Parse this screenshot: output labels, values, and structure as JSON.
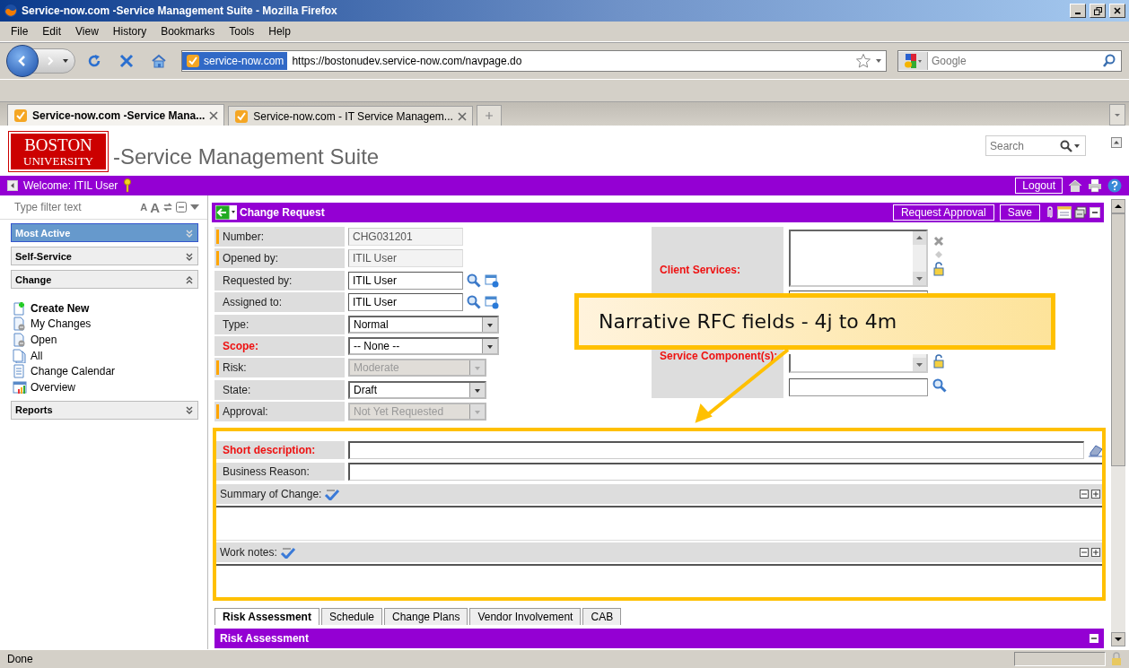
{
  "window": {
    "title": "Service-now.com -Service Management Suite - Mozilla Firefox"
  },
  "menu": [
    "File",
    "Edit",
    "View",
    "History",
    "Bookmarks",
    "Tools",
    "Help"
  ],
  "address": {
    "site": "service-now.com",
    "url": "https://bostonudev.service-now.com/navpage.do"
  },
  "web_search": {
    "placeholder": "Google"
  },
  "browser_tabs": [
    {
      "label": "Service-now.com -Service Mana...",
      "selected": true
    },
    {
      "label": "Service-now.com - IT Service Managem...",
      "selected": false
    }
  ],
  "header": {
    "logo": [
      "BOSTON",
      "UNIVERSITY"
    ],
    "title": "-Service Management Suite",
    "search_placeholder": "Search"
  },
  "user_bar": {
    "welcome": "Welcome: ITIL User",
    "logout": "Logout"
  },
  "sidebar": {
    "filter_placeholder": "Type filter text",
    "font_controls": [
      "A",
      "A"
    ],
    "sections": [
      {
        "label": "Most Active",
        "selected": true,
        "expanded": false
      },
      {
        "label": "Self-Service",
        "selected": false,
        "expanded": false
      },
      {
        "label": "Change",
        "selected": false,
        "expanded": true,
        "items": [
          {
            "label": "Create New",
            "kind": "create"
          },
          {
            "label": "My Changes",
            "kind": "filter"
          },
          {
            "label": "Open",
            "kind": "filter"
          },
          {
            "label": "All",
            "kind": "list"
          },
          {
            "label": "Change Calendar",
            "kind": "calendar"
          },
          {
            "label": "Overview",
            "kind": "chart"
          }
        ]
      },
      {
        "label": "Reports",
        "selected": false,
        "expanded": false
      }
    ]
  },
  "form": {
    "title": "Change Request",
    "buttons": [
      "Request Approval",
      "Save"
    ],
    "fields": [
      {
        "label": "Number:",
        "value": "CHG031201",
        "kind": "readonly",
        "mandatory": true,
        "required": false
      },
      {
        "label": "Opened by:",
        "value": "ITIL User",
        "kind": "readonly",
        "mandatory": true,
        "required": false
      },
      {
        "label": "Requested by:",
        "value": "ITIL User",
        "kind": "reference",
        "mandatory": false,
        "required": false
      },
      {
        "label": "Assigned to:",
        "value": "ITIL User",
        "kind": "reference",
        "mandatory": false,
        "required": false
      },
      {
        "label": "Type:",
        "value": "Normal",
        "kind": "select",
        "mandatory": false,
        "required": false,
        "disabled": false
      },
      {
        "label": "Scope:",
        "value": "-- None --",
        "kind": "select",
        "mandatory": false,
        "required": true,
        "disabled": false
      },
      {
        "label": "Risk:",
        "value": "Moderate",
        "kind": "select",
        "mandatory": true,
        "required": false,
        "disabled": true
      },
      {
        "label": "State:",
        "value": "Draft",
        "kind": "select",
        "mandatory": false,
        "required": false,
        "disabled": false
      },
      {
        "label": "Approval:",
        "value": "Not Yet Requested",
        "kind": "select",
        "mandatory": true,
        "required": false,
        "disabled": true
      }
    ],
    "side_labels": [
      "Client Services:",
      "Service Component(s):"
    ],
    "narrative": [
      {
        "label": "Short description:",
        "kind": "input",
        "required": true
      },
      {
        "label": "Business Reason:",
        "kind": "input",
        "required": false
      },
      {
        "label": "Summary of Change:",
        "kind": "journal",
        "required": false
      },
      {
        "label": "Work notes:",
        "kind": "journal",
        "required": false
      }
    ],
    "section_tabs": [
      {
        "label": "Risk Assessment",
        "selected": true
      },
      {
        "label": "Schedule",
        "selected": false
      },
      {
        "label": "Change Plans",
        "selected": false
      },
      {
        "label": "Vendor Involvement",
        "selected": false
      },
      {
        "label": "CAB",
        "selected": false
      }
    ],
    "section_title": "Risk Assessment"
  },
  "callout": {
    "text": "Narrative RFC fields - 4j to 4m"
  },
  "status_bar": {
    "text": "Done"
  }
}
